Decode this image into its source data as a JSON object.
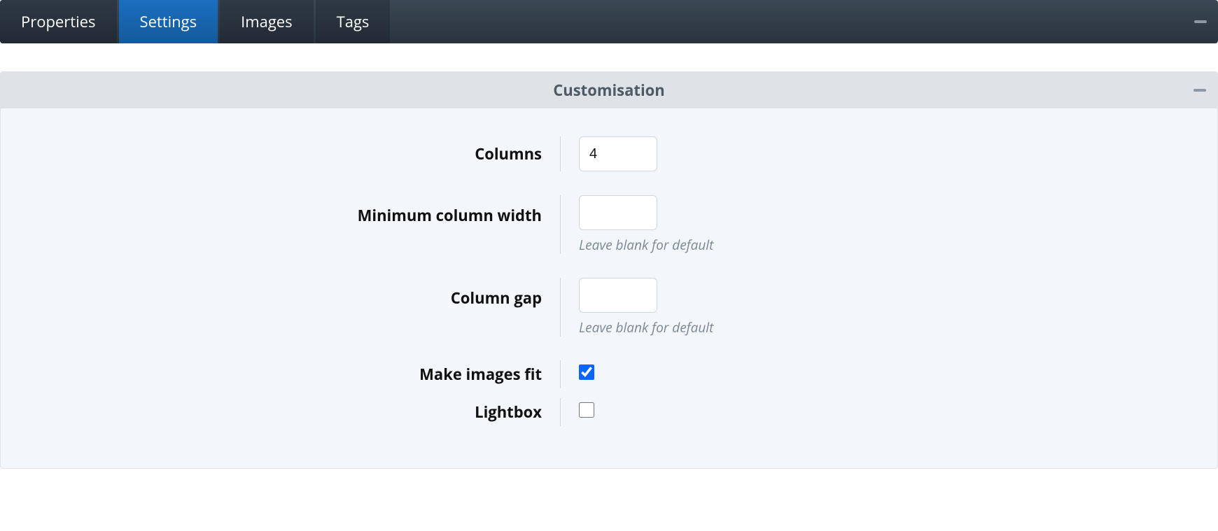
{
  "tabs": {
    "properties": "Properties",
    "settings": "Settings",
    "images": "Images",
    "tags": "Tags",
    "active": "settings"
  },
  "panel": {
    "title": "Customisation"
  },
  "form": {
    "columns": {
      "label": "Columns",
      "value": "4"
    },
    "min_col_width": {
      "label": "Minimum column width",
      "value": "",
      "help": "Leave blank for default"
    },
    "column_gap": {
      "label": "Column gap",
      "value": "",
      "help": "Leave blank for default"
    },
    "make_images_fit": {
      "label": "Make images fit",
      "checked": true
    },
    "lightbox": {
      "label": "Lightbox",
      "checked": false
    }
  },
  "icons": {
    "minimize": "minus"
  }
}
